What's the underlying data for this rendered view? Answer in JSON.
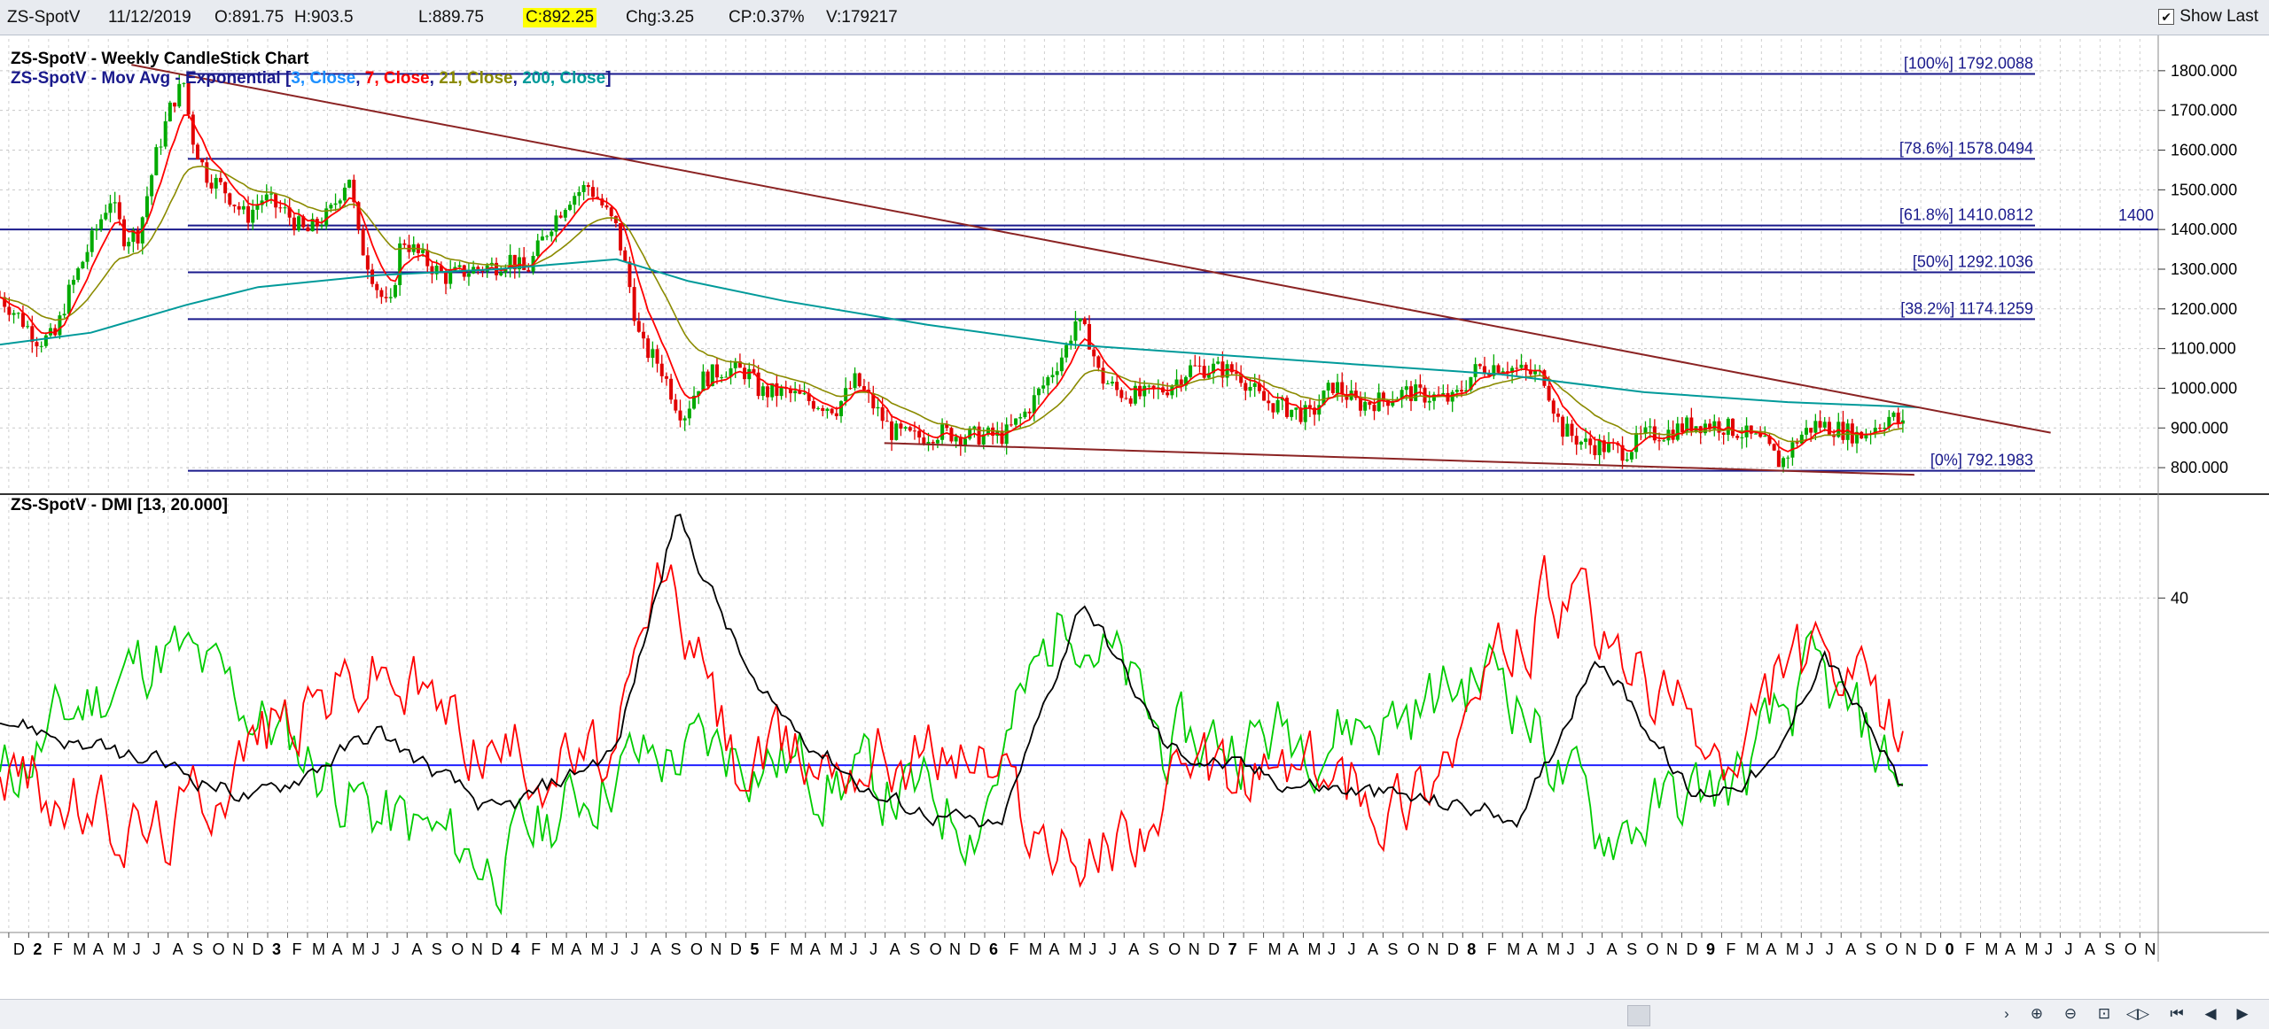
{
  "quote_bar": {
    "symbol": "ZS-SpotV",
    "date": "11/12/2019",
    "open": "O:891.75",
    "high": "H:903.5",
    "low": "L:889.75",
    "close": "C:892.25",
    "change": "Chg:3.25",
    "change_pct": "CP:0.37%",
    "volume": "V:179217",
    "show_last_label": "Show Last",
    "show_last_checked": true
  },
  "colors": {
    "up_candle": "#00aa00",
    "down_candle": "#e00000",
    "ema3": "#ff0000",
    "ema7": "#ff0000",
    "ema21": "#8b8b00",
    "ema200": "#009a9a",
    "fib_lines": "#1a1a8c",
    "trendline": "#8b2323",
    "dmi_plus": "#00cc00",
    "dmi_minus": "#ff0000",
    "adx": "#000000",
    "threshold": "#2020ff"
  },
  "chart_data": [
    {
      "type": "candlestick",
      "title": "ZS-SpotV - Weekly CandleStick Chart",
      "legend": {
        "prefix": "ZS-SpotV - Mov Avg - Exponential [",
        "items": [
          {
            "text": "3, Close",
            "color": "#1e90ff"
          },
          {
            "text": "7, Close",
            "color": "#ff0000"
          },
          {
            "text": "21, Close",
            "color": "#8b8b00"
          },
          {
            "text": "200, Close",
            "color": "#009a9a"
          }
        ],
        "suffix": "]"
      },
      "ylim": [
        740,
        1880
      ],
      "y_ticks": [
        800,
        900,
        1000,
        1100,
        1200,
        1300,
        1400,
        1500,
        1600,
        1700,
        1800
      ],
      "y_tick_labels": [
        "800.000",
        "900.000",
        "1000.000",
        "1100.000",
        "1200.000",
        "1300.000",
        "1400.000",
        "1500.000",
        "1600.000",
        "1700.000",
        "1800.000"
      ],
      "grid": true,
      "x_range": [
        2011.92,
        2020.95
      ],
      "x_tick_labels": [
        "D",
        "2",
        "F",
        "M",
        "A",
        "M",
        "J",
        "J",
        "A",
        "S",
        "O",
        "N",
        "D",
        "3",
        "F",
        "M",
        "A",
        "M",
        "J",
        "J",
        "A",
        "S",
        "O",
        "N",
        "D",
        "4",
        "F",
        "M",
        "A",
        "M",
        "J",
        "J",
        "A",
        "S",
        "O",
        "N",
        "D",
        "5",
        "F",
        "M",
        "A",
        "M",
        "J",
        "J",
        "A",
        "S",
        "O",
        "N",
        "D",
        "6",
        "F",
        "M",
        "A",
        "M",
        "J",
        "J",
        "A",
        "S",
        "O",
        "N",
        "D",
        "7",
        "F",
        "M",
        "A",
        "M",
        "J",
        "J",
        "A",
        "S",
        "O",
        "N",
        "D",
        "8",
        "F",
        "M",
        "A",
        "M",
        "J",
        "J",
        "A",
        "S",
        "O",
        "N",
        "D",
        "9",
        "F",
        "M",
        "A",
        "M",
        "J",
        "J",
        "A",
        "S",
        "O",
        "N",
        "D",
        "0",
        "F",
        "M",
        "A",
        "M",
        "J",
        "J",
        "A",
        "S",
        "O",
        "N"
      ],
      "fib_levels": [
        {
          "label": "[100%] 1792.0088",
          "value": 1792.0088
        },
        {
          "label": "[78.6%] 1578.0494",
          "value": 1578.0494
        },
        {
          "label": "[61.8%] 1410.0812",
          "value": 1410.0812
        },
        {
          "label": "[50%] 1292.1036",
          "value": 1292.1036
        },
        {
          "label": "[38.2%] 1174.1259",
          "value": 1174.1259
        },
        {
          "label": "[0%] 792.1983",
          "value": 792.1983
        }
      ],
      "horizontal_line": {
        "label": "1400",
        "value": 1400
      },
      "trendlines": [
        {
          "from": [
            2012.47,
            1815
          ],
          "to": [
            2020.5,
            888
          ]
        },
        {
          "from": [
            2015.62,
            862
          ],
          "to": [
            2019.93,
            782
          ]
        }
      ],
      "price_path": [
        [
          2011.92,
          1230
        ],
        [
          2012.0,
          1180
        ],
        [
          2012.08,
          1120
        ],
        [
          2012.15,
          1130
        ],
        [
          2012.2,
          1230
        ],
        [
          2012.28,
          1340
        ],
        [
          2012.38,
          1480
        ],
        [
          2012.44,
          1380
        ],
        [
          2012.5,
          1390
        ],
        [
          2012.57,
          1580
        ],
        [
          2012.64,
          1720
        ],
        [
          2012.69,
          1770
        ],
        [
          2012.72,
          1640
        ],
        [
          2012.78,
          1540
        ],
        [
          2012.86,
          1500
        ],
        [
          2012.95,
          1430
        ],
        [
          2013.02,
          1480
        ],
        [
          2013.12,
          1440
        ],
        [
          2013.2,
          1390
        ],
        [
          2013.3,
          1440
        ],
        [
          2013.38,
          1540
        ],
        [
          2013.42,
          1380
        ],
        [
          2013.5,
          1250
        ],
        [
          2013.55,
          1190
        ],
        [
          2013.6,
          1380
        ],
        [
          2013.68,
          1330
        ],
        [
          2013.78,
          1280
        ],
        [
          2013.9,
          1300
        ],
        [
          2014.0,
          1310
        ],
        [
          2014.05,
          1330
        ],
        [
          2014.12,
          1290
        ],
        [
          2014.22,
          1410
        ],
        [
          2014.3,
          1480
        ],
        [
          2014.38,
          1510
        ],
        [
          2014.42,
          1480
        ],
        [
          2014.5,
          1400
        ],
        [
          2014.55,
          1270
        ],
        [
          2014.6,
          1110
        ],
        [
          2014.68,
          1060
        ],
        [
          2014.75,
          960
        ],
        [
          2014.78,
          930
        ],
        [
          2014.85,
          1020
        ],
        [
          2014.95,
          1050
        ],
        [
          2015.05,
          1040
        ],
        [
          2015.1,
          990
        ],
        [
          2015.2,
          990
        ],
        [
          2015.3,
          970
        ],
        [
          2015.42,
          950
        ],
        [
          2015.5,
          1020
        ],
        [
          2015.57,
          960
        ],
        [
          2015.65,
          890
        ],
        [
          2015.75,
          875
        ],
        [
          2015.85,
          890
        ],
        [
          2015.95,
          880
        ],
        [
          2016.05,
          880
        ],
        [
          2016.12,
          880
        ],
        [
          2016.2,
          930
        ],
        [
          2016.3,
          1020
        ],
        [
          2016.38,
          1100
        ],
        [
          2016.42,
          1170
        ],
        [
          2016.48,
          1120
        ],
        [
          2016.52,
          1030
        ],
        [
          2016.6,
          990
        ],
        [
          2016.7,
          980
        ],
        [
          2016.8,
          1000
        ],
        [
          2016.9,
          1050
        ],
        [
          2017.0,
          1050
        ],
        [
          2017.1,
          1040
        ],
        [
          2017.2,
          970
        ],
        [
          2017.3,
          950
        ],
        [
          2017.4,
          930
        ],
        [
          2017.5,
          1010
        ],
        [
          2017.6,
          960
        ],
        [
          2017.7,
          970
        ],
        [
          2017.8,
          990
        ],
        [
          2017.9,
          980
        ],
        [
          2018.0,
          970
        ],
        [
          2018.1,
          1050
        ],
        [
          2018.2,
          1060
        ],
        [
          2018.3,
          1040
        ],
        [
          2018.38,
          1030
        ],
        [
          2018.45,
          900
        ],
        [
          2018.55,
          860
        ],
        [
          2018.65,
          850
        ],
        [
          2018.72,
          840
        ],
        [
          2018.8,
          880
        ],
        [
          2018.9,
          890
        ],
        [
          2019.0,
          910
        ],
        [
          2019.1,
          910
        ],
        [
          2019.2,
          890
        ],
        [
          2019.3,
          860
        ],
        [
          2019.37,
          810
        ],
        [
          2019.45,
          880
        ],
        [
          2019.52,
          910
        ],
        [
          2019.6,
          900
        ],
        [
          2019.7,
          880
        ],
        [
          2019.78,
          910
        ],
        [
          2019.83,
          930
        ],
        [
          2019.87,
          910
        ],
        [
          2019.9,
          892
        ]
      ],
      "ema200_path": [
        [
          2011.92,
          1110
        ],
        [
          2012.3,
          1140
        ],
        [
          2012.7,
          1210
        ],
        [
          2013.0,
          1255
        ],
        [
          2013.5,
          1285
        ],
        [
          2014.0,
          1300
        ],
        [
          2014.5,
          1325
        ],
        [
          2014.8,
          1270
        ],
        [
          2015.2,
          1220
        ],
        [
          2015.8,
          1160
        ],
        [
          2016.4,
          1110
        ],
        [
          2017.0,
          1085
        ],
        [
          2017.6,
          1060
        ],
        [
          2018.2,
          1035
        ],
        [
          2018.8,
          990
        ],
        [
          2019.4,
          965
        ],
        [
          2019.95,
          952
        ]
      ]
    },
    {
      "type": "line",
      "title": "ZS-SpotV - DMI [13, 20.000]",
      "ylim": [
        0,
        52
      ],
      "y_ticks": [
        40
      ],
      "y_tick_labels": [
        "40"
      ],
      "threshold": 20,
      "series": [
        {
          "key": "plus",
          "points": [
            [
              2011.92,
              18
            ],
            [
              2012.3,
              28
            ],
            [
              2012.6,
              34
            ],
            [
              2013.0,
              26
            ],
            [
              2013.5,
              14
            ],
            [
              2014.0,
              8
            ],
            [
              2014.5,
              20
            ],
            [
              2015.0,
              22
            ],
            [
              2015.5,
              18
            ],
            [
              2016.0,
              14
            ],
            [
              2016.4,
              40
            ],
            [
              2016.8,
              22
            ],
            [
              2017.3,
              24
            ],
            [
              2017.8,
              26
            ],
            [
              2018.2,
              32
            ],
            [
              2018.6,
              12
            ],
            [
              2019.2,
              18
            ],
            [
              2019.5,
              30
            ],
            [
              2019.9,
              18
            ]
          ]
        },
        {
          "key": "minus",
          "points": [
            [
              2011.92,
              20
            ],
            [
              2012.3,
              14
            ],
            [
              2012.6,
              12
            ],
            [
              2013.0,
              24
            ],
            [
              2013.5,
              32
            ],
            [
              2014.0,
              22
            ],
            [
              2014.5,
              20
            ],
            [
              2014.7,
              44
            ],
            [
              2015.0,
              20
            ],
            [
              2015.5,
              22
            ],
            [
              2016.0,
              22
            ],
            [
              2016.4,
              8
            ],
            [
              2016.8,
              16
            ],
            [
              2017.3,
              20
            ],
            [
              2017.8,
              16
            ],
            [
              2018.4,
              40
            ],
            [
              2018.8,
              30
            ],
            [
              2019.2,
              18
            ],
            [
              2019.4,
              34
            ],
            [
              2019.9,
              24
            ]
          ]
        },
        {
          "key": "adx",
          "points": [
            [
              2011.92,
              26
            ],
            [
              2012.3,
              22
            ],
            [
              2012.6,
              20
            ],
            [
              2013.0,
              16
            ],
            [
              2013.5,
              24
            ],
            [
              2014.0,
              14
            ],
            [
              2014.5,
              22
            ],
            [
              2014.75,
              50
            ],
            [
              2015.1,
              28
            ],
            [
              2015.6,
              16
            ],
            [
              2016.1,
              12
            ],
            [
              2016.45,
              40
            ],
            [
              2016.8,
              22
            ],
            [
              2017.3,
              18
            ],
            [
              2017.8,
              16
            ],
            [
              2018.3,
              14
            ],
            [
              2018.6,
              34
            ],
            [
              2019.0,
              16
            ],
            [
              2019.35,
              20
            ],
            [
              2019.55,
              34
            ],
            [
              2019.9,
              16
            ]
          ]
        }
      ]
    }
  ]
}
